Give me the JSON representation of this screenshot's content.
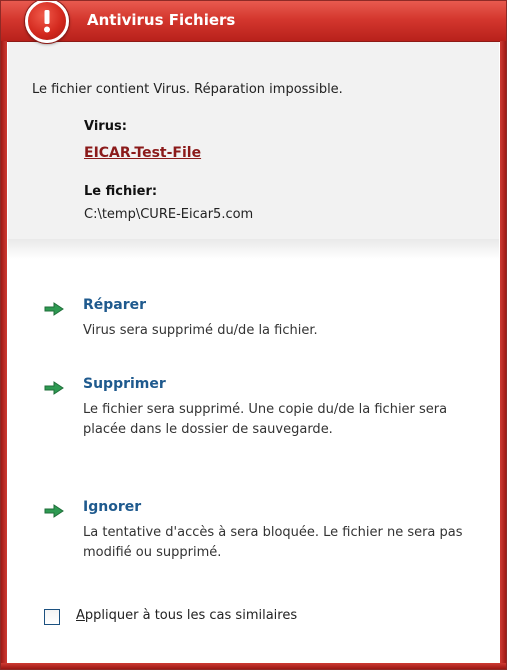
{
  "window": {
    "title": "Antivirus Fichiers",
    "accent_color": "#d4372e"
  },
  "info": {
    "message": "Le fichier contient Virus. Réparation impossible.",
    "virus_label": "Virus:",
    "virus_name": "EICAR-Test-File",
    "file_label": "Le fichier:",
    "file_path": "C:\\temp\\CURE-Eicar5.com"
  },
  "actions": [
    {
      "icon": "green-arrow-icon",
      "title": "Réparer",
      "description": "Virus sera supprimé du/de la fichier."
    },
    {
      "icon": "green-arrow-icon",
      "title": "Supprimer",
      "description": "Le fichier sera supprimé. Une copie du/de la fichier sera placée dans le dossier de sauvegarde."
    },
    {
      "icon": "green-arrow-icon",
      "title": "Ignorer",
      "description": "La tentative d'accès à  sera bloquée. Le fichier ne sera pas modifié ou supprimé."
    }
  ],
  "apply_all": {
    "label": "Appliquer à tous les cas similaires",
    "checked": false
  }
}
